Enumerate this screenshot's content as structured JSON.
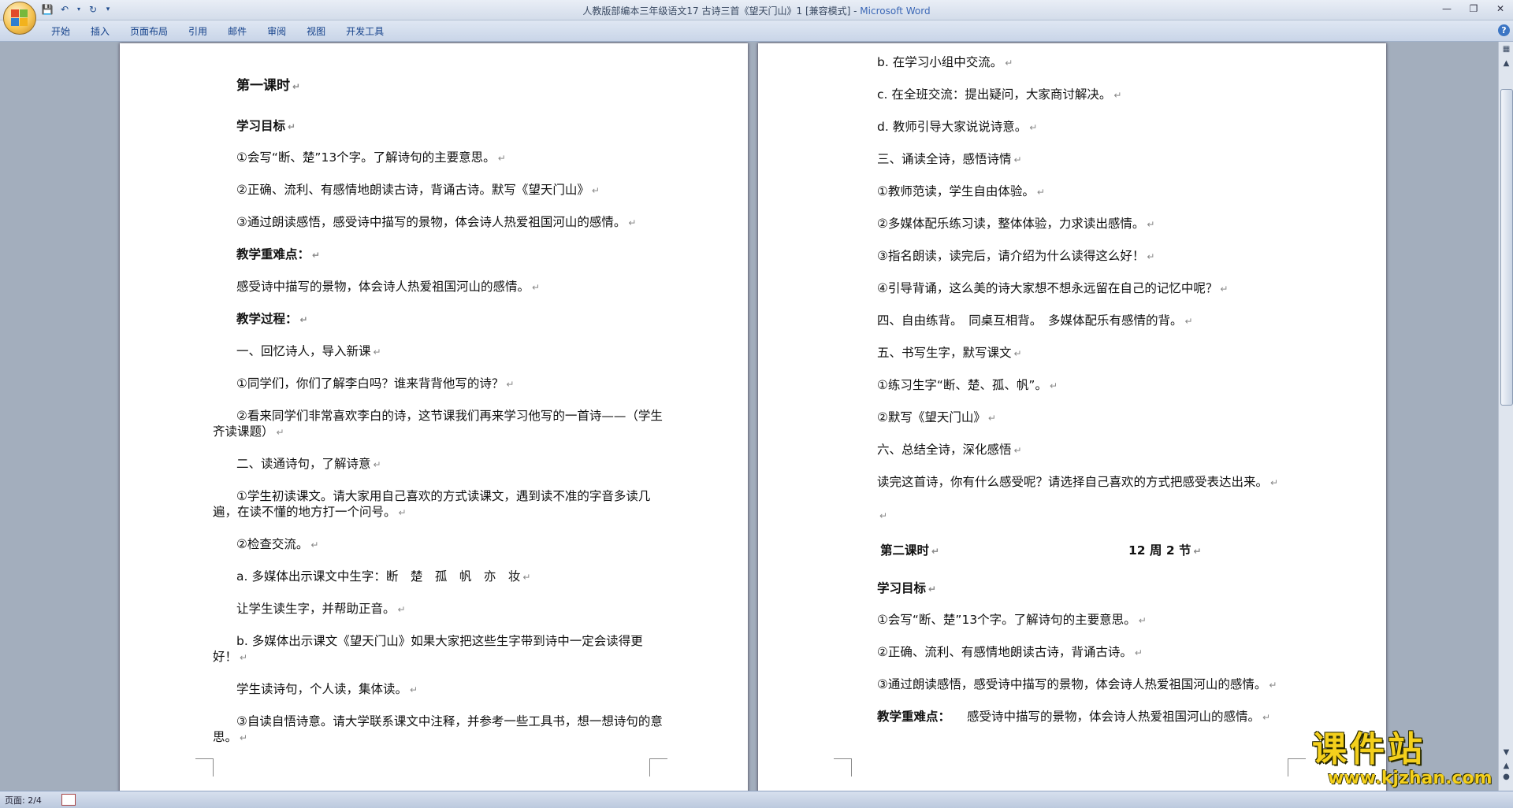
{
  "window": {
    "title": "人教版部编本三年级语文17 古诗三首《望天门山》1 [兼容模式]",
    "app_name": "Microsoft Word"
  },
  "ribbon": {
    "tabs": [
      "开始",
      "插入",
      "页面布局",
      "引用",
      "邮件",
      "审阅",
      "视图",
      "开发工具"
    ]
  },
  "status": {
    "page": "页面: 2/4"
  },
  "watermark": {
    "logo": "课件站",
    "url": "www.kjzhan.com"
  },
  "left_page": [
    "第一课时",
    "学习目标",
    "①会写“断、楚”13个字。了解诗句的主要意思。",
    "②正确、流利、有感情地朗读古诗，背诵古诗。默写《望天门山》",
    "③通过朗读感悟，感受诗中描写的景物，体会诗人热爱祖国河山的感情。",
    "教学重难点：",
    "感受诗中描写的景物，体会诗人热爱祖国河山的感情。",
    "教学过程：",
    "一、回忆诗人，导入新课",
    "①同学们，你们了解李白吗？谁来背背他写的诗？",
    "②看来同学们非常喜欢李白的诗，这节课我们再来学习他写的一首诗——（学生齐读课题）",
    "二、读通诗句，了解诗意",
    "①学生初读课文。请大家用自己喜欢的方式读课文，遇到读不准的字音多读几遍，在读不懂的地方打一个问号。",
    "②检查交流。",
    "a. 多媒体出示课文中生字：断　楚　孤　帆　亦　妆",
    "让学生读生字，并帮助正音。",
    "b. 多媒体出示课文《望天门山》如果大家把这些生字带到诗中一定会读得更好！",
    "学生读诗句，个人读，集体读。",
    "③自读自悟诗意。请大学联系课文中注释，并参考一些工具书，想一想诗句的意思。"
  ],
  "right_page": [
    "b. 在学习小组中交流。",
    "c. 在全班交流：提出疑问，大家商讨解决。",
    "d. 教师引导大家说说诗意。",
    "三、诵读全诗，感悟诗情",
    "①教师范读，学生自由体验。",
    "②多媒体配乐练习读，整体体验，力求读出感情。",
    "③指名朗读，读完后，请介绍为什么读得这么好！",
    "④引导背诵，这么美的诗大家想不想永远留在自己的记忆中呢？",
    "四、自由练背。　同桌互相背。　多媒体配乐有感情的背。",
    "五、书写生字，默写课文",
    "①练习生字“断、楚、孤、帆”。",
    "②默写《望天门山》",
    "六、总结全诗，深化感悟",
    "读完这首诗，你有什么感受呢？请选择自己喜欢的方式把感受表达出来。",
    "",
    "第二课时",
    "12 周 2 节",
    "学习目标",
    "①会写“断、楚”13个字。了解诗句的主要意思。",
    "②正确、流利、有感情地朗读古诗，背诵古诗。",
    "③通过朗读感悟，感受诗中描写的景物，体会诗人热爱祖国河山的感情。",
    "教学重难点：",
    "感受诗中描写的景物，体会诗人热爱祖国河山的感情。"
  ]
}
